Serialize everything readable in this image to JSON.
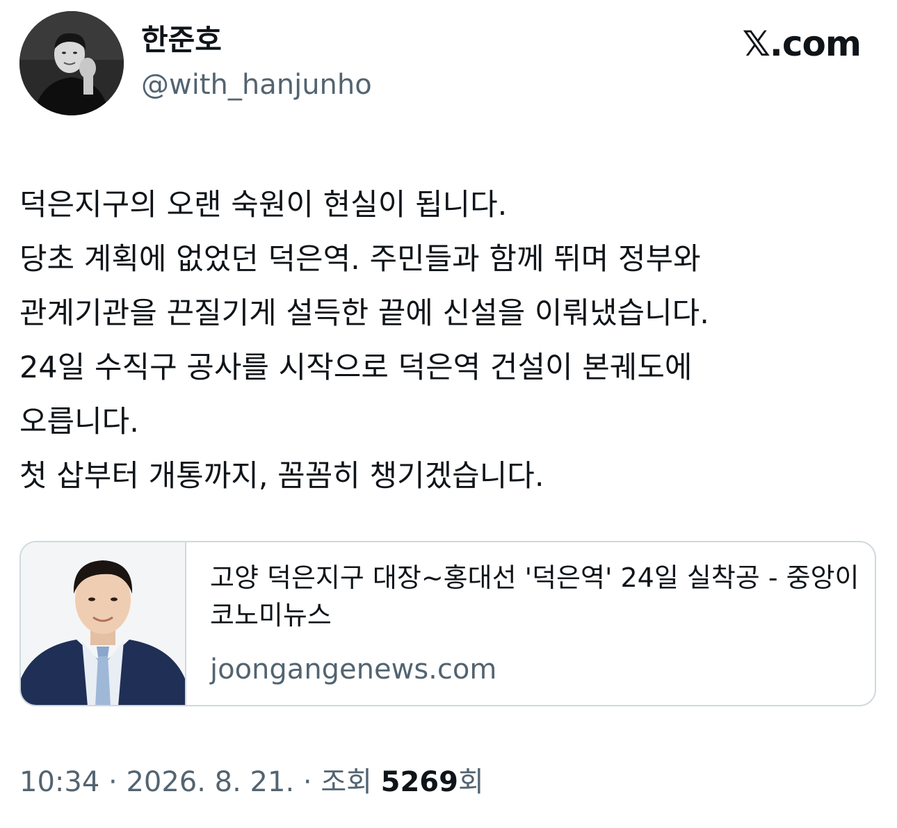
{
  "author": {
    "display_name": "한준호",
    "handle": "@with_hanjunho",
    "avatar_icon": "profile-photo-bw"
  },
  "brand": {
    "label": "𝕏.com"
  },
  "tweet": {
    "lines": [
      "덕은지구의 오랜 숙원이 현실이 됩니다.",
      "당초 계획에 없었던 덕은역. 주민들과 함께 뛰며 정부와",
      "관계기관을 끈질기게 설득한 끝에 신설을 이뤄냈습니다.",
      "24일 수직구 공사를 시작으로 덕은역 건설이 본궤도에",
      "오릅니다.",
      "첫 삽부터 개통까지, 꼼꼼히 챙기겠습니다."
    ]
  },
  "link_card": {
    "title": "고양 덕은지구 대장~홍대선 '덕은역' 24일 실착공 - 중앙이코노미뉴스",
    "domain": "joongangenews.com",
    "thumbnail_icon": "portrait-photo"
  },
  "meta": {
    "time": "10:34",
    "date": "2026. 8. 21.",
    "views_label": "조회",
    "views_count": "5269",
    "views_suffix": "회",
    "separator": " · "
  },
  "colors": {
    "text_primary": "#0f1419",
    "text_secondary": "#536471",
    "border": "#cfd9de",
    "background": "#ffffff"
  }
}
